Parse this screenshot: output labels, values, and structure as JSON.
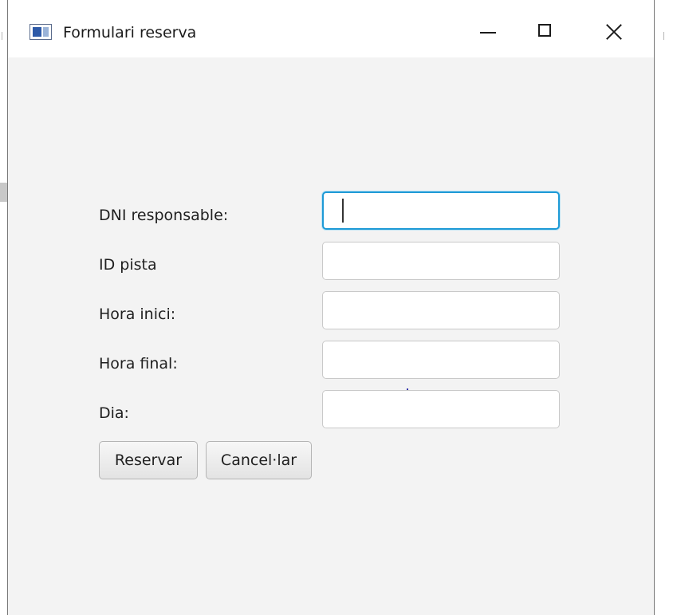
{
  "window": {
    "title": "Formulari reserva",
    "icon": "app-window-icon",
    "controls": [
      "minimize-icon",
      "maximize-icon",
      "close-icon"
    ]
  },
  "form": {
    "fields": [
      {
        "label": "DNI responsable:",
        "value": "",
        "focused": true
      },
      {
        "label": "ID pista",
        "value": ""
      },
      {
        "label": "Hora inici:",
        "value": ""
      },
      {
        "label": "Hora final:",
        "value": ""
      },
      {
        "label": "Dia:",
        "value": ""
      }
    ],
    "buttons": {
      "reservar": "Reservar",
      "cancel": "Cancel·lar"
    }
  },
  "colors": {
    "focus_border": "#1e9ad6",
    "background": "#f3f3f3"
  }
}
